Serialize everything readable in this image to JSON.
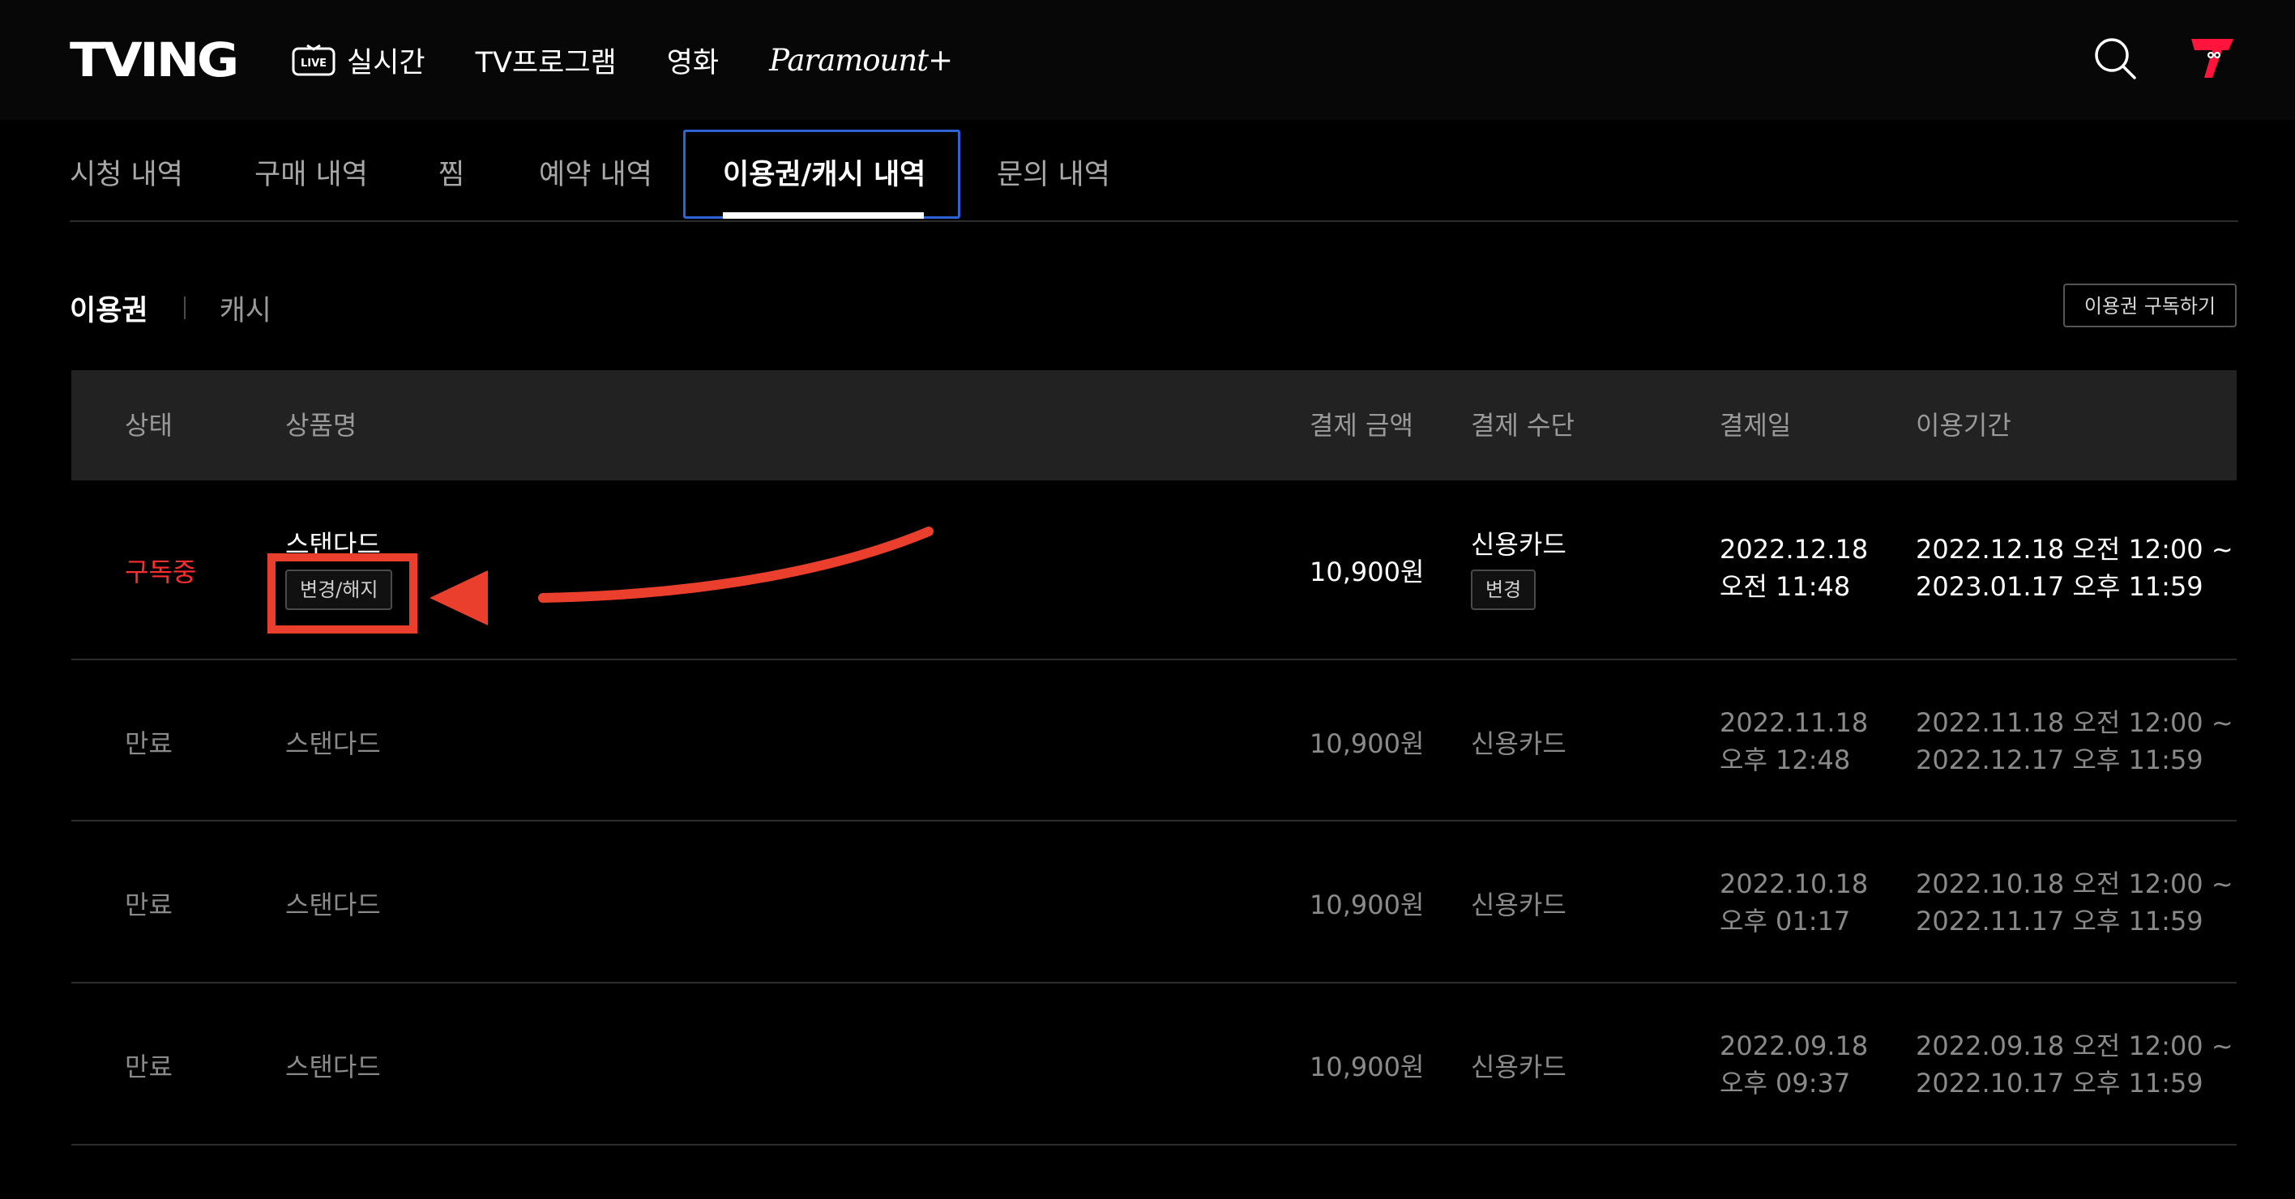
{
  "header": {
    "logo": "TVING",
    "nav": [
      {
        "label": "실시간",
        "icon": "live-icon",
        "icon_text": "LIVE"
      },
      {
        "label": "TV프로그램"
      },
      {
        "label": "영화"
      },
      {
        "label": "Paramount+"
      }
    ],
    "search_icon": "search-icon",
    "profile_icon": "profile-icon",
    "accent_color": "#ff153c"
  },
  "tabs": [
    {
      "label": "시청 내역",
      "active": false
    },
    {
      "label": "구매 내역",
      "active": false
    },
    {
      "label": "찜",
      "active": false
    },
    {
      "label": "예약 내역",
      "active": false
    },
    {
      "label": "이용권/캐시 내역",
      "active": true
    },
    {
      "label": "문의 내역",
      "active": false
    }
  ],
  "subtabs": [
    {
      "label": "이용권",
      "active": true
    },
    {
      "label": "캐시",
      "active": false
    }
  ],
  "subscribe_button": "이용권 구독하기",
  "table": {
    "headers": [
      "상태",
      "상품명",
      "결제 금액",
      "결제 수단",
      "결제일",
      "이용기간"
    ],
    "rows": [
      {
        "status": "구독중",
        "product": "스탠다드",
        "product_button": "변경/해지",
        "amount": "10,900원",
        "method": "신용카드",
        "method_button": "변경",
        "pay_date": "2022.12.18",
        "pay_time": "오전 11:48",
        "period_start": "2022.12.18 오전 12:00 ~",
        "period_end": "2023.01.17 오후 11:59"
      },
      {
        "status": "만료",
        "product": "스탠다드",
        "amount": "10,900원",
        "method": "신용카드",
        "pay_date": "2022.11.18",
        "pay_time": "오후 12:48",
        "period_start": "2022.11.18 오전 12:00 ~",
        "period_end": "2022.12.17 오후 11:59"
      },
      {
        "status": "만료",
        "product": "스탠다드",
        "amount": "10,900원",
        "method": "신용카드",
        "pay_date": "2022.10.18",
        "pay_time": "오후 01:17",
        "period_start": "2022.10.18 오전 12:00 ~",
        "period_end": "2022.11.17 오후 11:59"
      },
      {
        "status": "만료",
        "product": "스탠다드",
        "amount": "10,900원",
        "method": "신용카드",
        "pay_date": "2022.09.18",
        "pay_time": "오후 09:37",
        "period_start": "2022.09.18 오전 12:00 ~",
        "period_end": "2022.10.17 오후 11:59"
      }
    ]
  },
  "annotation": {
    "color": "#ea3f2c"
  }
}
